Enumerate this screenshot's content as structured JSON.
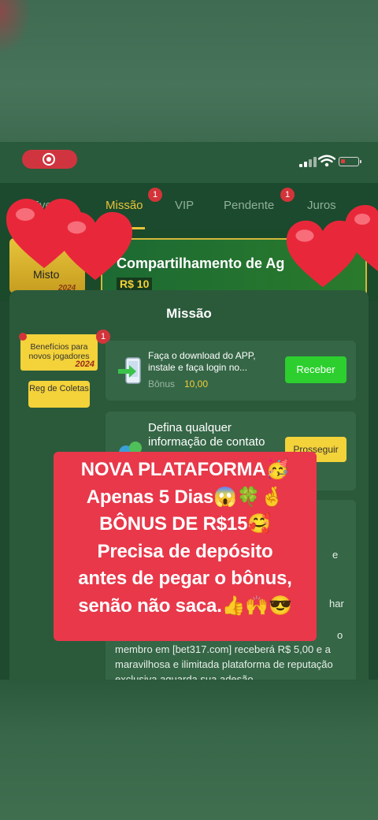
{
  "status_bar": {
    "battery_color": "#e23b3b"
  },
  "tabs": [
    {
      "label": "Eventos",
      "badge": ""
    },
    {
      "label": "Missão",
      "badge": "1"
    },
    {
      "label": "VIP",
      "badge": ""
    },
    {
      "label": "Pendente",
      "badge": "1"
    },
    {
      "label": "Juros",
      "badge": ""
    }
  ],
  "promo_strip": {
    "misto_label": "Misto",
    "misto_year": "2024",
    "banner_title": "Compartilhamento de Ag",
    "banner_amount": "R$ 10"
  },
  "modal": {
    "title": "Missão",
    "side_card": {
      "text": "Benefícios para novos jogadores",
      "year": "2024",
      "badge": "1"
    },
    "reg_button": "Reg de Coletas",
    "tasks": [
      {
        "text": "Faça o download do APP, instale e faça login no...",
        "bonus_label": "Bônus",
        "bonus_value": "10,00",
        "button": "Receber"
      },
      {
        "text": "Defina qualquer informação de contato",
        "button": "Prosseguir"
      }
    ],
    "task3_fragments": [
      "e",
      "har",
      "o"
    ],
    "task3_text": "membro em [bet317.com] receberá R$ 5,00 e a maravilhosa e ilimitada plataforma de reputação exclusiva aguarda sua adesão"
  },
  "overlay": {
    "lines": [
      "NOVA PLATAFORMA🥳",
      "Apenas 5 Dias😱🍀🤞",
      "BÔNUS DE R$15🥰",
      "Precisa de depósito",
      "antes de pegar o bônus,",
      "senão não saca.👍🙌😎"
    ],
    "background_color": "#e8384a"
  },
  "colors": {
    "accent": "#e8c33a",
    "primary_bg": "#1f4a30",
    "button_green": "#2ccf2e",
    "button_yellow": "#f3d23a",
    "heart": "#e8283a"
  }
}
